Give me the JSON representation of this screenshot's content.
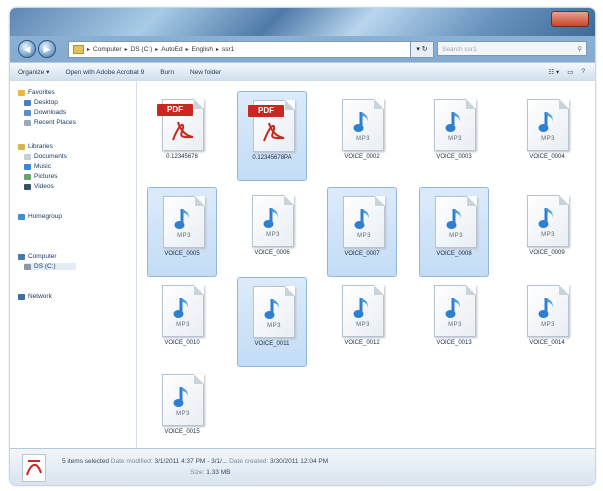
{
  "address_bar": {
    "segments": [
      "Computer",
      "DS (C:)",
      "AutoEd",
      "English",
      "ssr1"
    ]
  },
  "search": {
    "placeholder": "Search ssr1"
  },
  "toolbar": {
    "organize": "Organize ▾",
    "open_with": "Open with Adobe Acrobat 9",
    "burn": "Burn",
    "new_folder": "New folder"
  },
  "sidebar": {
    "favorites": "Favorites",
    "desktop": "Desktop",
    "downloads": "Downloads",
    "recent": "Recent Places",
    "libraries": "Libraries",
    "documents": "Documents",
    "music": "Music",
    "pictures": "Pictures",
    "videos": "Videos",
    "homegroup": "Homegroup",
    "computer": "Computer",
    "drive": "DS (C:)",
    "network": "Network"
  },
  "files": [
    {
      "name": "0.12345678",
      "type": "pdf",
      "selected": false
    },
    {
      "name": "0.12345678PA",
      "type": "pdf",
      "selected": true
    },
    {
      "name": "VOICE_0002",
      "type": "mp3",
      "selected": false
    },
    {
      "name": "VOICE_0003",
      "type": "mp3",
      "selected": false
    },
    {
      "name": "VOICE_0004",
      "type": "mp3",
      "selected": false
    },
    {
      "name": "VOICE_0005",
      "type": "mp3",
      "selected": true
    },
    {
      "name": "VOICE_0006",
      "type": "mp3",
      "selected": false
    },
    {
      "name": "VOICE_0007",
      "type": "mp3",
      "selected": true
    },
    {
      "name": "VOICE_0008",
      "type": "mp3",
      "selected": true
    },
    {
      "name": "VOICE_0009",
      "type": "mp3",
      "selected": false
    },
    {
      "name": "VOICE_0010",
      "type": "mp3",
      "selected": false
    },
    {
      "name": "VOICE_0011",
      "type": "mp3",
      "selected": true
    },
    {
      "name": "VOICE_0012",
      "type": "mp3",
      "selected": false
    },
    {
      "name": "VOICE_0013",
      "type": "mp3",
      "selected": false
    },
    {
      "name": "VOICE_0014",
      "type": "mp3",
      "selected": false
    },
    {
      "name": "VOICE_0015",
      "type": "mp3",
      "selected": false
    }
  ],
  "mp3_label": "MP3",
  "pdf_label": "PDF",
  "status": {
    "selected": "5 items selected",
    "modified_label": "Date modified:",
    "modified_value": "3/1/2011 4:37 PM - 3/1/...",
    "created_label": "Date created:",
    "created_value": "3/30/2011 12:04 PM",
    "size_label": "Size:",
    "size_value": "1.33 MB"
  }
}
